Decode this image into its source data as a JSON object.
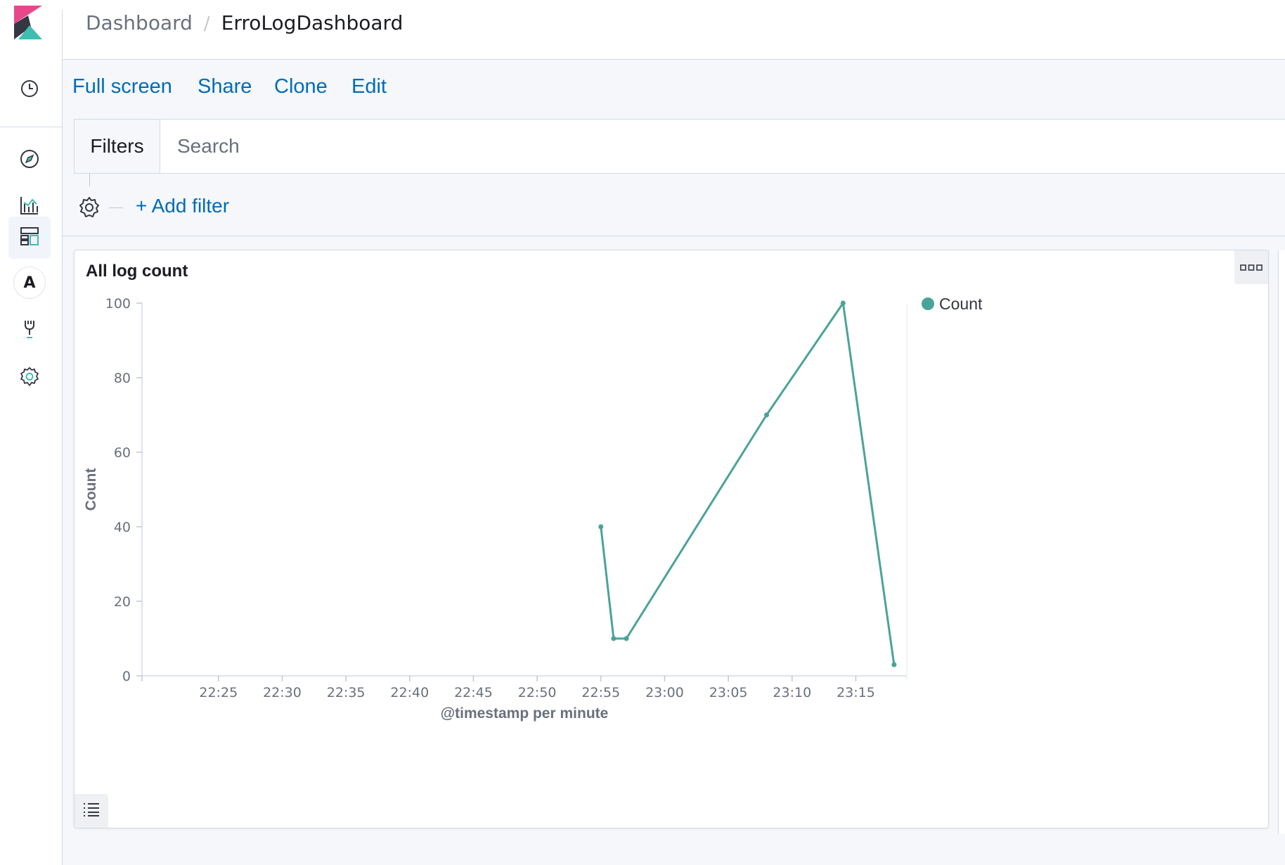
{
  "breadcrumbs": {
    "root": "Dashboard",
    "current": "ErroLogDashboard"
  },
  "sidenav": {
    "items": [
      {
        "icon": "clock-icon"
      },
      {
        "icon": "compass-icon"
      },
      {
        "icon": "visualize-icon"
      },
      {
        "icon": "dashboard-icon",
        "active": true
      },
      {
        "icon": "letter-a-icon",
        "letter": "A"
      },
      {
        "icon": "dev-tools-icon"
      },
      {
        "icon": "gear-icon"
      }
    ]
  },
  "topnav": {
    "full_screen": "Full screen",
    "share": "Share",
    "clone": "Clone",
    "edit": "Edit"
  },
  "query": {
    "filters_label": "Filters",
    "placeholder": "Search"
  },
  "filterbar": {
    "add_filter": "+ Add filter"
  },
  "panel": {
    "title": "All log count"
  },
  "colors": {
    "accent": "#006bb8",
    "series": "#4aa399",
    "axis_text": "#69707d"
  },
  "chart_data": {
    "type": "line",
    "title": "All log count",
    "xlabel": "@timestamp per minute",
    "ylabel": "Count",
    "x_tick_labels": [
      "22:25",
      "22:30",
      "22:35",
      "22:40",
      "22:45",
      "22:50",
      "22:55",
      "23:00",
      "23:05",
      "23:10",
      "23:15"
    ],
    "y_ticks": [
      0,
      20,
      40,
      60,
      80,
      100
    ],
    "ylim": [
      0,
      100
    ],
    "legend": {
      "position": "right",
      "entries": [
        "Count"
      ]
    },
    "grid": false,
    "series": [
      {
        "name": "Count",
        "color": "#4aa399",
        "points": [
          {
            "x": "22:55",
            "y": 40
          },
          {
            "x": "22:56",
            "y": 10
          },
          {
            "x": "22:57",
            "y": 10
          },
          {
            "x": "23:08",
            "y": 70
          },
          {
            "x": "23:14",
            "y": 100
          },
          {
            "x": "23:18",
            "y": 3
          }
        ]
      }
    ]
  }
}
